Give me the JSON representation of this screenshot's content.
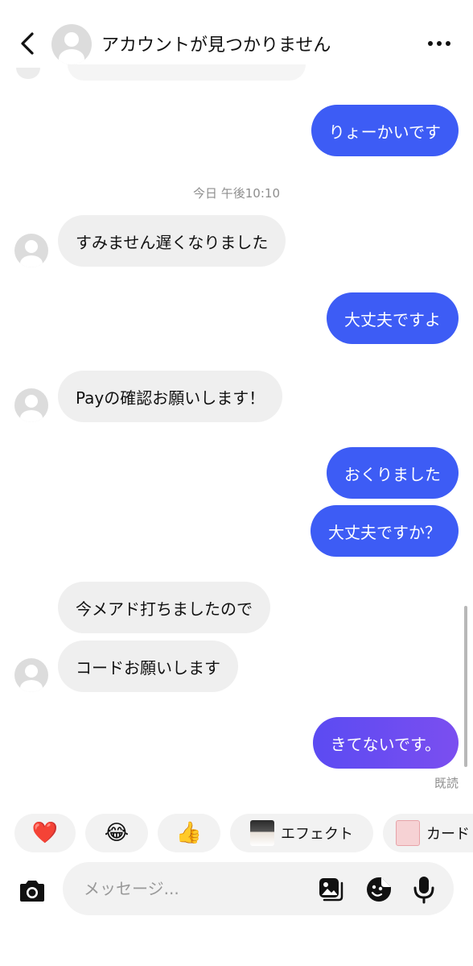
{
  "header": {
    "title": "アカウントが見つかりません"
  },
  "timestamp": "今日 午後10:10",
  "messages": [
    {
      "dir": "out",
      "text": "りょーかいです"
    },
    {
      "dir": "in",
      "text": "すみません遅くなりました"
    },
    {
      "dir": "out",
      "text": "大丈夫ですよ"
    },
    {
      "dir": "in",
      "text": "Payの確認お願いします！"
    },
    {
      "dir": "out",
      "text": "おくりました"
    },
    {
      "dir": "out",
      "text": "大丈夫ですか？"
    },
    {
      "dir": "in",
      "text": "今メアド打ちましたので"
    },
    {
      "dir": "in",
      "text": "コードお願いします"
    },
    {
      "dir": "out",
      "text": "きてないです。"
    }
  ],
  "read_receipt": "既読",
  "quick_reactions": {
    "heart": "❤️",
    "laugh": "😂",
    "thumbs_up": "👍",
    "effect_label": "エフェクト",
    "card_label": "カード"
  },
  "composer": {
    "placeholder": "メッセージ..."
  },
  "icons": [
    "back-chevron-icon",
    "more-dots-icon",
    "camera-icon",
    "gallery-icon",
    "sticker-icon",
    "microphone-icon"
  ],
  "colors": {
    "outgoing_blue": "#3d5cf5",
    "outgoing_purple": "#7b4ef0",
    "incoming_gray": "#efefef"
  }
}
